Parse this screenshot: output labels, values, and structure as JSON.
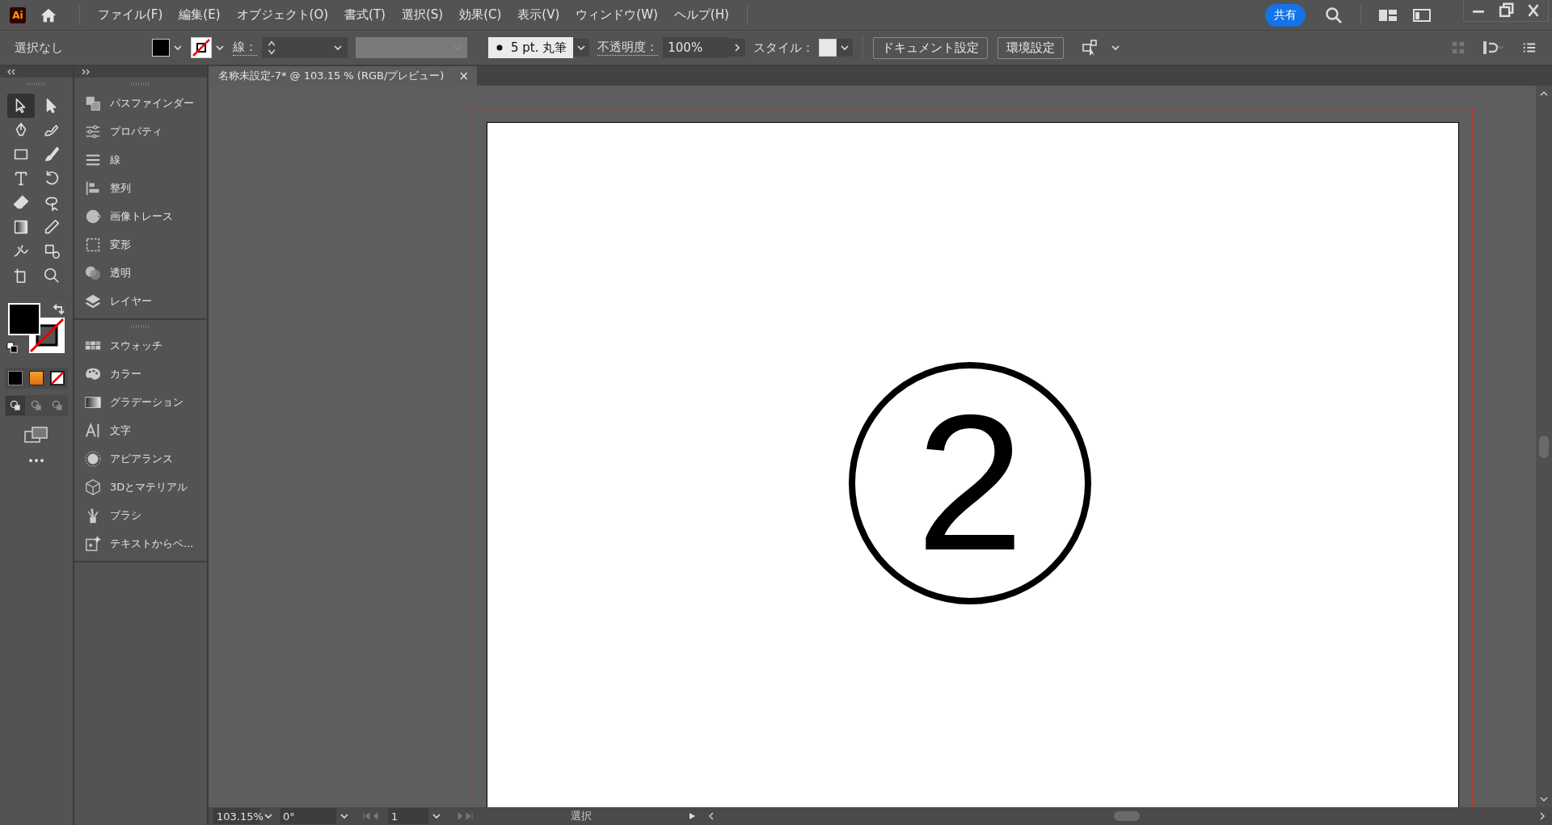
{
  "app_logo": "Ai",
  "menu": [
    "ファイル(F)",
    "編集(E)",
    "オブジェクト(O)",
    "書式(T)",
    "選択(S)",
    "効果(C)",
    "表示(V)",
    "ウィンドウ(W)",
    "ヘルプ(H)"
  ],
  "share_button": "共有",
  "control_bar": {
    "selection": "選択なし",
    "stroke_label": "線：",
    "brush": "5 pt. 丸筆",
    "opacity_label": "不透明度：",
    "opacity": "100%",
    "style_label": "スタイル：",
    "buttons": [
      "ドキュメント設定",
      "環境設定"
    ]
  },
  "document_tab": {
    "title": "名称未設定-7* @ 103.15 % (RGB/プレビュー)",
    "close": "×"
  },
  "tools": [
    {
      "kind": "selection",
      "selected": true
    },
    {
      "kind": "direct",
      "selected": false
    },
    {
      "kind": "pen",
      "selected": false
    },
    {
      "kind": "curvature",
      "selected": false
    },
    {
      "kind": "rectangle",
      "selected": false
    },
    {
      "kind": "brush",
      "selected": false
    },
    {
      "kind": "type",
      "selected": false
    },
    {
      "kind": "rotate",
      "selected": false
    },
    {
      "kind": "eraser",
      "selected": false
    },
    {
      "kind": "lasso",
      "selected": false
    },
    {
      "kind": "gradient",
      "selected": false
    },
    {
      "kind": "eyedropper",
      "selected": false
    },
    {
      "kind": "puppet",
      "selected": false
    },
    {
      "kind": "shapebuilder",
      "selected": false
    },
    {
      "kind": "artboard",
      "selected": false
    },
    {
      "kind": "zoom",
      "selected": false
    }
  ],
  "draw_modes": [
    {
      "selected": true
    },
    {
      "selected": false
    },
    {
      "selected": false
    }
  ],
  "panels": [
    [
      {
        "kind": "pathfinder",
        "label": "パスファインダー"
      },
      {
        "kind": "properties",
        "label": "プロパティ"
      },
      {
        "kind": "stroke",
        "label": "線"
      },
      {
        "kind": "align",
        "label": "整列"
      },
      {
        "kind": "trace",
        "label": "画像トレース"
      },
      {
        "kind": "transform",
        "label": "変形"
      },
      {
        "kind": "transparency",
        "label": "透明"
      },
      {
        "kind": "layers",
        "label": "レイヤー"
      }
    ],
    [
      {
        "kind": "swatches",
        "label": "スウォッチ"
      },
      {
        "kind": "color",
        "label": "カラー"
      },
      {
        "kind": "gradient",
        "label": "グラデーション"
      },
      {
        "kind": "character",
        "label": "文字"
      },
      {
        "kind": "appearance",
        "label": "アピアランス"
      },
      {
        "kind": "material",
        "label": "3Dとマテリアル"
      },
      {
        "kind": "brushes",
        "label": "ブラシ"
      },
      {
        "kind": "textvector",
        "label": "テキストからベ..."
      }
    ]
  ],
  "artwork": {
    "text": "2"
  },
  "status_bar": {
    "zoom": "103.15%",
    "rotation": "0°",
    "artboard": "1",
    "tool": "選択"
  }
}
